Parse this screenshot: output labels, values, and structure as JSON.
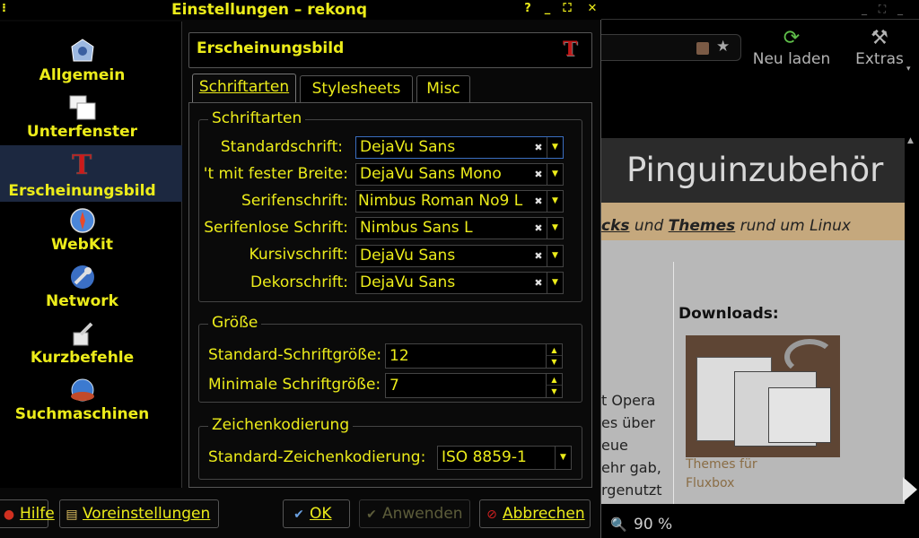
{
  "dialog": {
    "title": "Einstellungen – rekonq",
    "titlebar_buttons": {
      "help": "?",
      "minimize": "_",
      "maximize": "⛶",
      "close": "✕"
    }
  },
  "sidebar": {
    "items": [
      {
        "label": "Allgemein",
        "icon": "general-settings-icon"
      },
      {
        "label": "Unterfenster",
        "icon": "tabs-icon"
      },
      {
        "label": "Erscheinungsbild",
        "icon": "appearance-icon"
      },
      {
        "label": "WebKit",
        "icon": "webkit-compass-icon"
      },
      {
        "label": "Network",
        "icon": "network-icon"
      },
      {
        "label": "Kurzbefehle",
        "icon": "shortcuts-icon"
      },
      {
        "label": "Suchmaschinen",
        "icon": "search-engines-icon"
      }
    ],
    "active_index": 2
  },
  "page": {
    "title": "Erscheinungsbild",
    "tabs": [
      {
        "label": "Schriftarten",
        "mnemonic": "S"
      },
      {
        "label": "Stylesheets",
        "mnemonic": "t"
      },
      {
        "label": "Misc",
        "mnemonic": "M"
      }
    ],
    "fonts_group": {
      "title": "Schriftarten",
      "rows": [
        {
          "label": "Standardschrift:",
          "value": "DejaVu Sans"
        },
        {
          "label": "'t mit fester Breite:",
          "value": "DejaVu Sans Mono"
        },
        {
          "label": "Serifenschrift:",
          "value": "Nimbus Roman No9 L"
        },
        {
          "label": "Serifenlose Schrift:",
          "value": "Nimbus Sans L"
        },
        {
          "label": "Kursivschrift:",
          "value": "DejaVu Sans"
        },
        {
          "label": "Dekorschrift:",
          "value": "DejaVu Sans"
        }
      ]
    },
    "size_group": {
      "title": "Größe",
      "default_label": "Standard-Schriftgröße:",
      "default_value": "12",
      "min_label": "Minimale Schriftgröße:",
      "min_value": "7"
    },
    "encoding_group": {
      "title": "Zeichenkodierung",
      "label": "Standard-Zeichenkodierung:",
      "value": "ISO 8859-1"
    }
  },
  "buttons": {
    "help": "Hilfe",
    "defaults": "Voreinstellungen",
    "ok": "OK",
    "apply": "Anwenden",
    "cancel": "Abbrechen"
  },
  "browser": {
    "reload_label": "Neu laden",
    "extras_label": "Extras",
    "page_title": "Pinguinzubehör",
    "subline_link1": "cks",
    "subline_mid": " und ",
    "subline_link2": "Themes",
    "subline_tail": " rund um Linux",
    "downloads_title": "Downloads:",
    "thumb_caption": "Themes für Fluxbox",
    "left_text": [
      "t Opera",
      "es über",
      "eue",
      "ehr gab,",
      "rgenutzt"
    ],
    "zoom_level": "90 %"
  },
  "colors": {
    "text": "#ecec1a",
    "background": "#000000",
    "active_sidebar": "#1c2840",
    "focus_border": "#3a6ec0"
  }
}
